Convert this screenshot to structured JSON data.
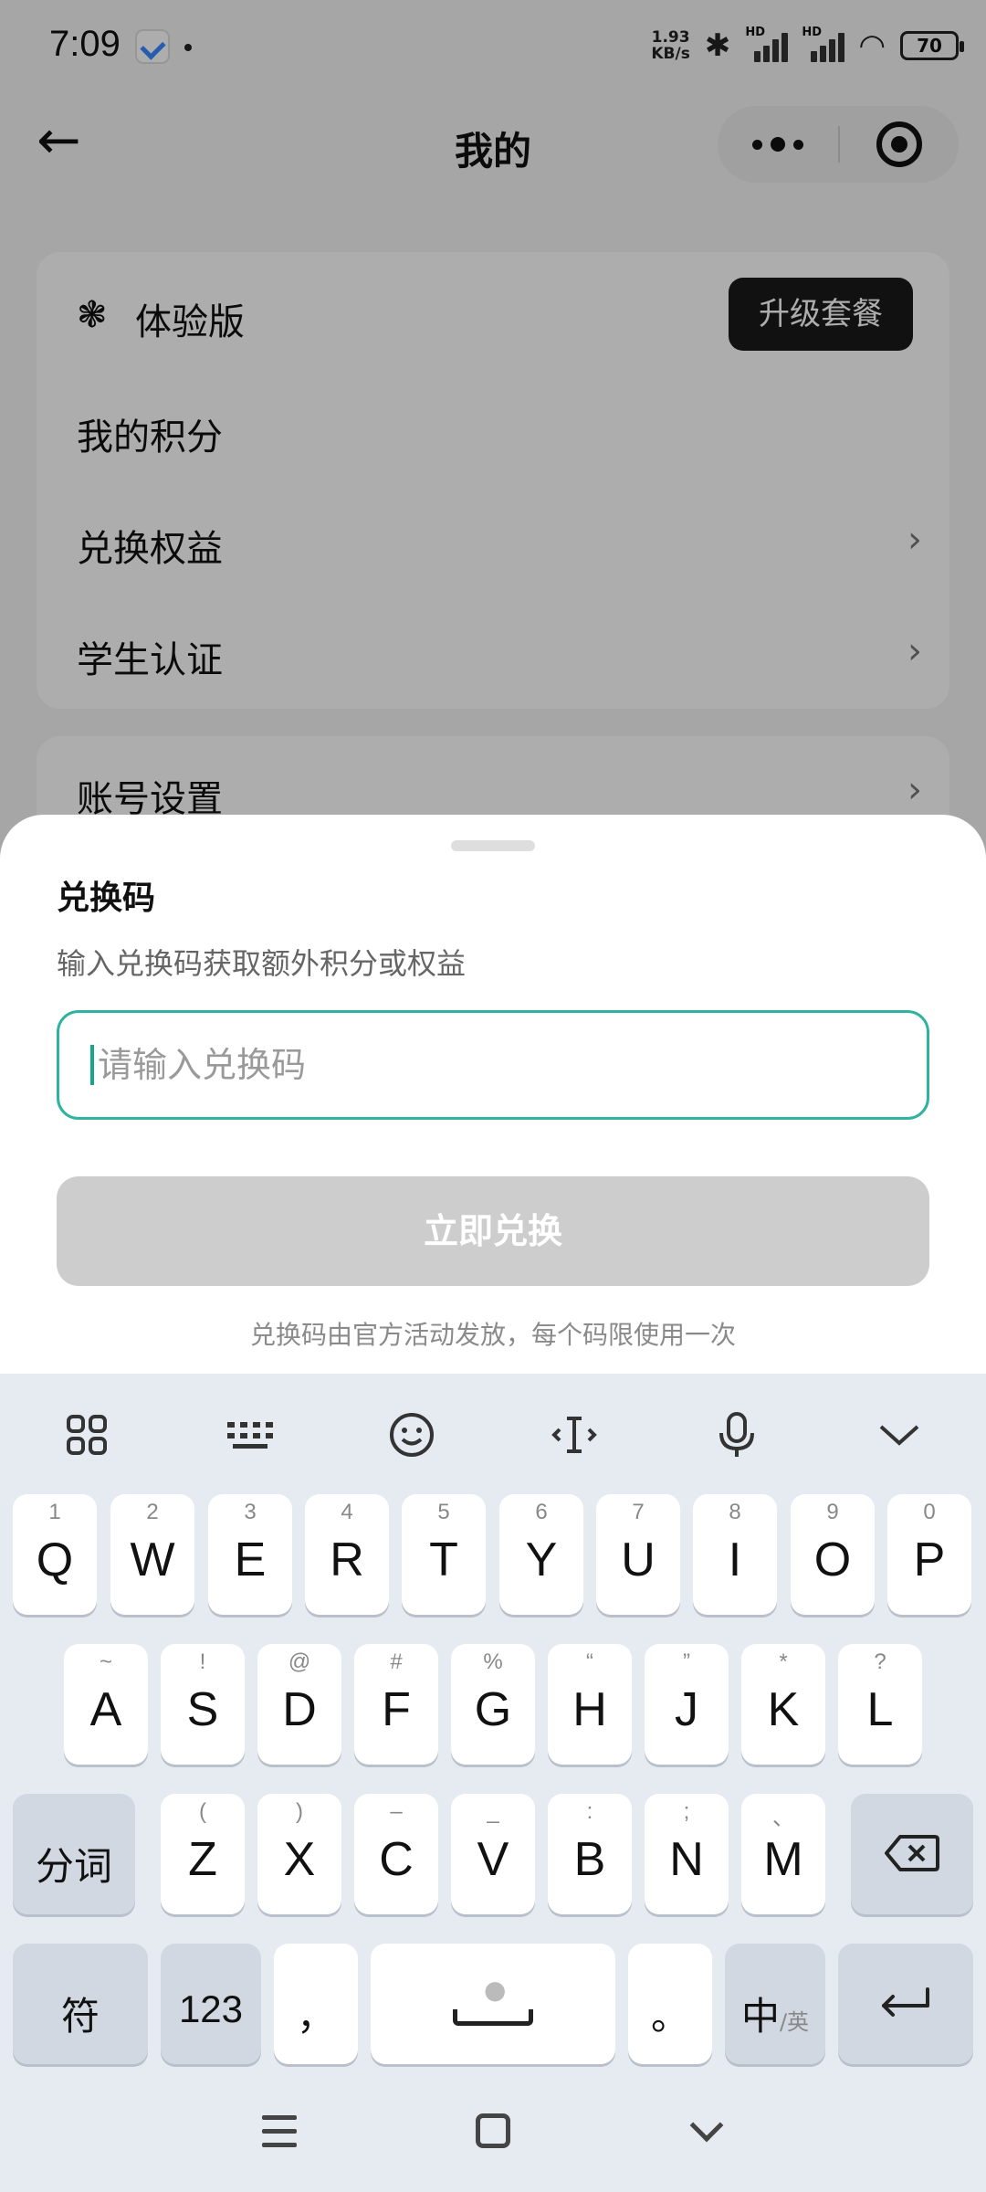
{
  "status_bar": {
    "time": "7:09",
    "net_speed_value": "1.93",
    "net_speed_unit": "KB/s",
    "signal_label": "HD",
    "battery": "70"
  },
  "nav": {
    "title": "我的",
    "back_icon": "arrow-left-icon"
  },
  "profile_card": {
    "plan_label": "体验版",
    "upgrade_label": "升级套餐",
    "rows": [
      {
        "label": "我的积分"
      },
      {
        "label": "兑换权益"
      },
      {
        "label": "学生认证"
      }
    ]
  },
  "settings_card": {
    "label": "账号设置"
  },
  "redeem_sheet": {
    "title": "兑换码",
    "subtitle": "输入兑换码获取额外积分或权益",
    "input_placeholder": "请输入兑换码",
    "input_value": "",
    "submit_label": "立即兑换",
    "note": "兑换码由官方活动发放，每个码限使用一次"
  },
  "keyboard": {
    "row1": [
      {
        "hint": "1",
        "key": "Q"
      },
      {
        "hint": "2",
        "key": "W"
      },
      {
        "hint": "3",
        "key": "E"
      },
      {
        "hint": "4",
        "key": "R"
      },
      {
        "hint": "5",
        "key": "T"
      },
      {
        "hint": "6",
        "key": "Y"
      },
      {
        "hint": "7",
        "key": "U"
      },
      {
        "hint": "8",
        "key": "I"
      },
      {
        "hint": "9",
        "key": "O"
      },
      {
        "hint": "0",
        "key": "P"
      }
    ],
    "row2": [
      {
        "hint": "~",
        "key": "A"
      },
      {
        "hint": "!",
        "key": "S"
      },
      {
        "hint": "@",
        "key": "D"
      },
      {
        "hint": "#",
        "key": "F"
      },
      {
        "hint": "%",
        "key": "G"
      },
      {
        "hint": "“",
        "key": "H"
      },
      {
        "hint": "”",
        "key": "J"
      },
      {
        "hint": "*",
        "key": "K"
      },
      {
        "hint": "?",
        "key": "L"
      }
    ],
    "row3": [
      {
        "hint": "(",
        "key": "Z"
      },
      {
        "hint": ")",
        "key": "X"
      },
      {
        "hint": "–",
        "key": "C"
      },
      {
        "hint": "_",
        "key": "V"
      },
      {
        "hint": ":",
        "key": "B"
      },
      {
        "hint": ";",
        "key": "N"
      },
      {
        "hint": "、",
        "key": "M"
      }
    ],
    "segment_label": "分词",
    "symbol_label": "符",
    "number_label": "123",
    "comma_label": "，",
    "period_label": "。",
    "lang_main": "中",
    "lang_sub": "/英"
  }
}
